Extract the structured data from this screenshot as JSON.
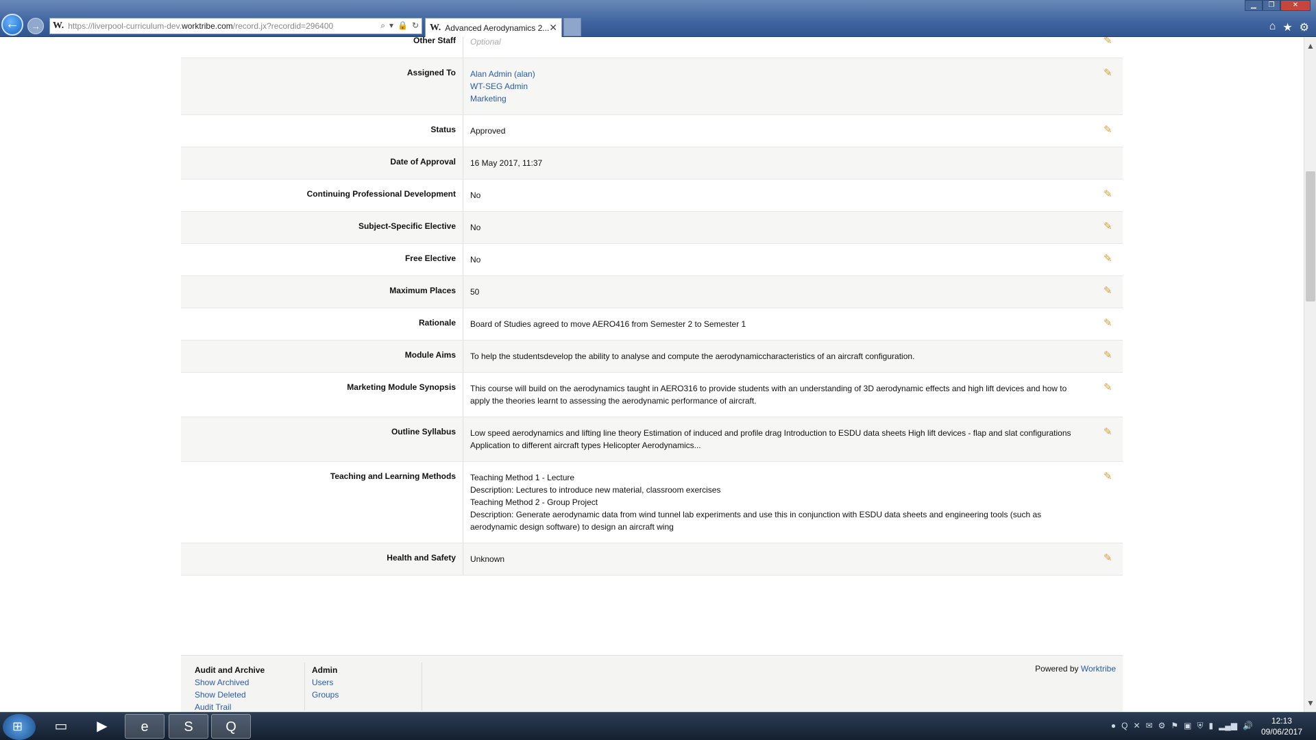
{
  "browser": {
    "url_prefix": "https://liverpool-curriculum-dev.",
    "url_domain": "worktribe.com",
    "url_path": "/record.jx?recordid=296400",
    "favicon": "W.",
    "tab_title": "Advanced Aerodynamics 2...",
    "tab_close": "✕",
    "back_glyph": "←",
    "fwd_glyph": "→",
    "addr_tools": [
      "⌕",
      "▾",
      "🔒",
      "↻"
    ],
    "right_icons": [
      "⌂",
      "★",
      "⚙"
    ],
    "win_controls": [
      "▁",
      "❐",
      "✕"
    ]
  },
  "record": {
    "rows": [
      {
        "label": "Other Staff",
        "value_muted": "Optional",
        "editable": true
      },
      {
        "label": "Assigned To",
        "links": [
          "Alan Admin (alan)",
          "WT-SEG Admin",
          "Marketing"
        ],
        "editable": true
      },
      {
        "label": "Status",
        "lines": [
          "Approved"
        ],
        "editable": true
      },
      {
        "label": "Date of Approval",
        "lines": [
          "16 May 2017, 11:37"
        ],
        "editable": false
      },
      {
        "label": "Continuing Professional Development",
        "lines": [
          "No"
        ],
        "editable": true
      },
      {
        "label": "Subject-Specific Elective",
        "lines": [
          "No"
        ],
        "editable": true
      },
      {
        "label": "Free Elective",
        "lines": [
          "No"
        ],
        "editable": true
      },
      {
        "label": "Maximum Places",
        "lines": [
          "50"
        ],
        "editable": true
      },
      {
        "label": "Rationale",
        "lines": [
          "Board of Studies agreed to move AERO416 from Semester 2 to Semester 1"
        ],
        "editable": true
      },
      {
        "label": "Module Aims",
        "lines": [
          "To help the studentsdevelop the ability to analyse and compute the aerodynamiccharacteristics of an aircraft configuration."
        ],
        "editable": true
      },
      {
        "label": "Marketing Module Synopsis",
        "lines": [
          "This course will build on the aerodynamics taught in AERO316 to provide students with an understanding of 3D aerodynamic effects and high lift devices and how to apply the theories learnt to assessing the aerodynamic performance of aircraft."
        ],
        "editable": true
      },
      {
        "label": "Outline Syllabus",
        "lines": [
          "Low speed aerodynamics and lifting line theory Estimation of induced and profile drag Introduction to ESDU data sheets High lift devices - flap and slat configurations Application to different aircraft types Helicopter Aerodynamics..."
        ],
        "editable": true
      },
      {
        "label": "Teaching and Learning Methods",
        "lines": [
          "Teaching Method 1 - Lecture",
          "Description: Lectures to introduce new material, classroom exercises",
          "Teaching Method 2 - Group Project",
          "Description: Generate aerodynamic data from wind tunnel lab experiments and use this in conjunction with ESDU data sheets and engineering tools (such as aerodynamic design software) to design an aircraft wing"
        ],
        "editable": true
      },
      {
        "label": "Health and Safety",
        "lines": [
          "Unknown"
        ],
        "editable": true
      }
    ],
    "edit_glyph": "✎"
  },
  "footer": {
    "audit": {
      "heading": "Audit and Archive",
      "links": [
        "Show Archived",
        "Show Deleted",
        "Audit Trail"
      ]
    },
    "admin": {
      "heading": "Admin",
      "links": [
        "Users",
        "Groups"
      ]
    },
    "powered_by": "Powered by",
    "powered_link": "Worktribe"
  },
  "taskbar": {
    "start_glyph": "⊞",
    "items": [
      {
        "name": "file-explorer",
        "glyph": "▭"
      },
      {
        "name": "media-player",
        "glyph": "▶"
      },
      {
        "name": "internet-explorer",
        "glyph": "e"
      },
      {
        "name": "skype",
        "glyph": "S"
      },
      {
        "name": "search-app",
        "glyph": "Q"
      }
    ],
    "tray": [
      "●",
      "Q",
      "✕",
      "✉",
      "⚙",
      "⚑",
      "▣",
      "⛨",
      "▮",
      "▂▄▆",
      "🔊"
    ],
    "time": "12:13",
    "date": "09/06/2017"
  },
  "colors": {
    "link": "#2a5aa8",
    "edit_icon": "#d9a23c"
  }
}
